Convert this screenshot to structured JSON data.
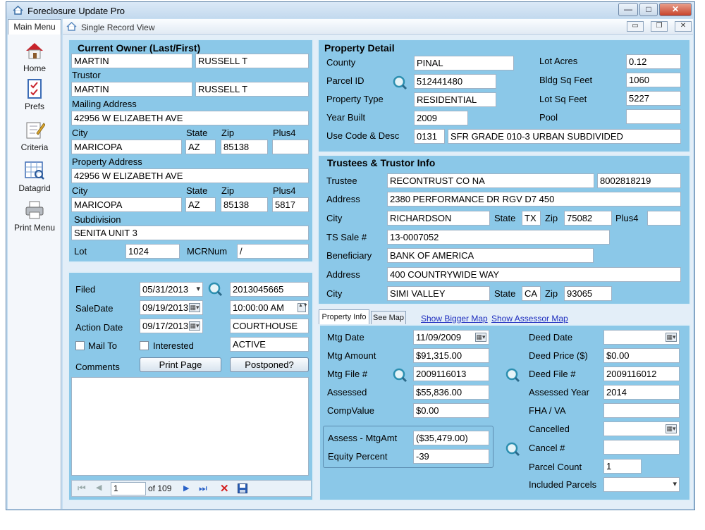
{
  "app": {
    "title": "Foreclosure Update Pro",
    "main_menu_tab": "Main Menu",
    "inner_title": "Single Record View"
  },
  "window_controls": {
    "minimize": "—",
    "maximize": "□",
    "close": "✕"
  },
  "inner_controls": {
    "minimize": "▭",
    "restore": "❐",
    "close": "✕"
  },
  "nav": [
    {
      "label": "Home",
      "icon": "home-icon"
    },
    {
      "label": "Prefs",
      "icon": "checklist-icon"
    },
    {
      "label": "Criteria",
      "icon": "notepad-pencil-icon"
    },
    {
      "label": "Datagrid",
      "icon": "grid-magnifier-icon"
    },
    {
      "label": "Print Menu",
      "icon": "printer-icon"
    }
  ],
  "owner": {
    "header": "Current Owner (Last/First)",
    "last": "MARTIN",
    "first": "RUSSELL T",
    "trustor_label": "Trustor",
    "trustor_last": "MARTIN",
    "trustor_first": "RUSSELL T",
    "mailing_label": "Mailing Address",
    "mailing": "42956 W ELIZABETH AVE",
    "city_label": "City",
    "state_label": "State",
    "zip_label": "Zip",
    "plus4_label": "Plus4",
    "mail_city": "MARICOPA",
    "mail_state": "AZ",
    "mail_zip": "85138",
    "mail_plus4": "",
    "property_label": "Property Address",
    "property": "42956 W ELIZABETH AVE",
    "prop_city": "MARICOPA",
    "prop_state": "AZ",
    "prop_zip": "85138",
    "prop_plus4": "5817",
    "subdivision_label": "Subdivision",
    "subdivision": "SENITA UNIT 3",
    "lot_label": "Lot",
    "lot": "1024",
    "mcr_label": "MCRNum",
    "mcr": "/"
  },
  "filing": {
    "filed_label": "Filed",
    "filed": "05/31/2013",
    "doc_no": "2013045665",
    "saledate_label": "SaleDate",
    "saledate": "09/19/2013",
    "saletime": "10:00:00 AM",
    "actiondate_label": "Action Date",
    "actiondate": "09/17/2013",
    "location": "COURTHOUSE",
    "mailto_label": "Mail To",
    "interested_label": "Interested",
    "status": "ACTIVE",
    "comments_label": "Comments",
    "print_button": "Print Page",
    "postponed_button": "Postponed?",
    "comments": ""
  },
  "navigator": {
    "first": "⏮",
    "prev": "◀",
    "position": "1",
    "of_text": "of 109",
    "next": "▶",
    "last": "⏭",
    "delete": "✕",
    "save": "💾"
  },
  "property": {
    "header": "Property Detail",
    "county_label": "County",
    "county": "PINAL",
    "parcel_label": "Parcel ID",
    "parcel": "512441480",
    "type_label": "Property Type",
    "type": "RESIDENTIAL",
    "year_label": "Year Built",
    "year": "2009",
    "usecode_label": "Use Code & Desc",
    "usecode": "0131",
    "usedesc": "SFR GRADE 010-3 URBAN SUBDIVIDED",
    "lotacres_label": "Lot Acres",
    "lotacres": "0.12",
    "bldg_label": "Bldg Sq Feet",
    "bldg": "1060",
    "lotsq_label": "Lot Sq Feet",
    "lotsq": "5227",
    "pool_label": "Pool",
    "pool": ""
  },
  "trustee": {
    "header": "Trustees & Trustor Info",
    "trustee_label": "Trustee",
    "trustee": "RECONTRUST CO NA",
    "phone": "8002818219",
    "address_label": "Address",
    "address": "2380 PERFORMANCE DR RGV D7 450",
    "city_label": "City",
    "city": "RICHARDSON",
    "state_label": "State",
    "state": "TX",
    "zip_label": "Zip",
    "zip": "75082",
    "plus4_label": "Plus4",
    "plus4": "",
    "tssale_label": "TS Sale #",
    "tssale": "13-0007052",
    "beneficiary_label": "Beneficiary",
    "beneficiary": "BANK OF AMERICA",
    "ben_address_label": "Address",
    "ben_address": "400 COUNTRYWIDE WAY",
    "ben_city_label": "City",
    "ben_city": "SIMI VALLEY",
    "ben_state_label": "State",
    "ben_state": "CA",
    "ben_zip_label": "Zip",
    "ben_zip": "93065"
  },
  "tabs": {
    "property_info": "Property Info",
    "see_map": "See Map",
    "bigger_map": "Show Bigger Map",
    "assessor_map": "Show Assessor Map"
  },
  "mortgage": {
    "mtgdate_label": "Mtg Date",
    "mtgdate": "11/09/2009",
    "mtgamt_label": "Mtg Amount",
    "mtgamt": "$91,315.00",
    "mtgfile_label": "Mtg File #",
    "mtgfile": "2009116013",
    "assessed_label": "Assessed",
    "assessed": "$55,836.00",
    "compvalue_label": "CompValue",
    "compvalue": "$0.00",
    "assessmtg_label": "Assess - MtgAmt",
    "assessmtg": "($35,479.00)",
    "equity_label": "Equity Percent",
    "equity": "-39",
    "deeddate_label": "Deed Date",
    "deeddate": "",
    "deedprice_label": "Deed Price ($)",
    "deedprice": "$0.00",
    "deedfile_label": "Deed File #",
    "deedfile": "2009116012",
    "assessyear_label": "Assessed Year",
    "assessyear": "2014",
    "fha_label": "FHA / VA",
    "fha": "",
    "cancelled_label": "Cancelled",
    "cancelled": "",
    "cancelno_label": "Cancel #",
    "cancelno": "",
    "parcelcount_label": "Parcel Count",
    "parcelcount": "1",
    "included_label": "Included Parcels",
    "included": ""
  }
}
